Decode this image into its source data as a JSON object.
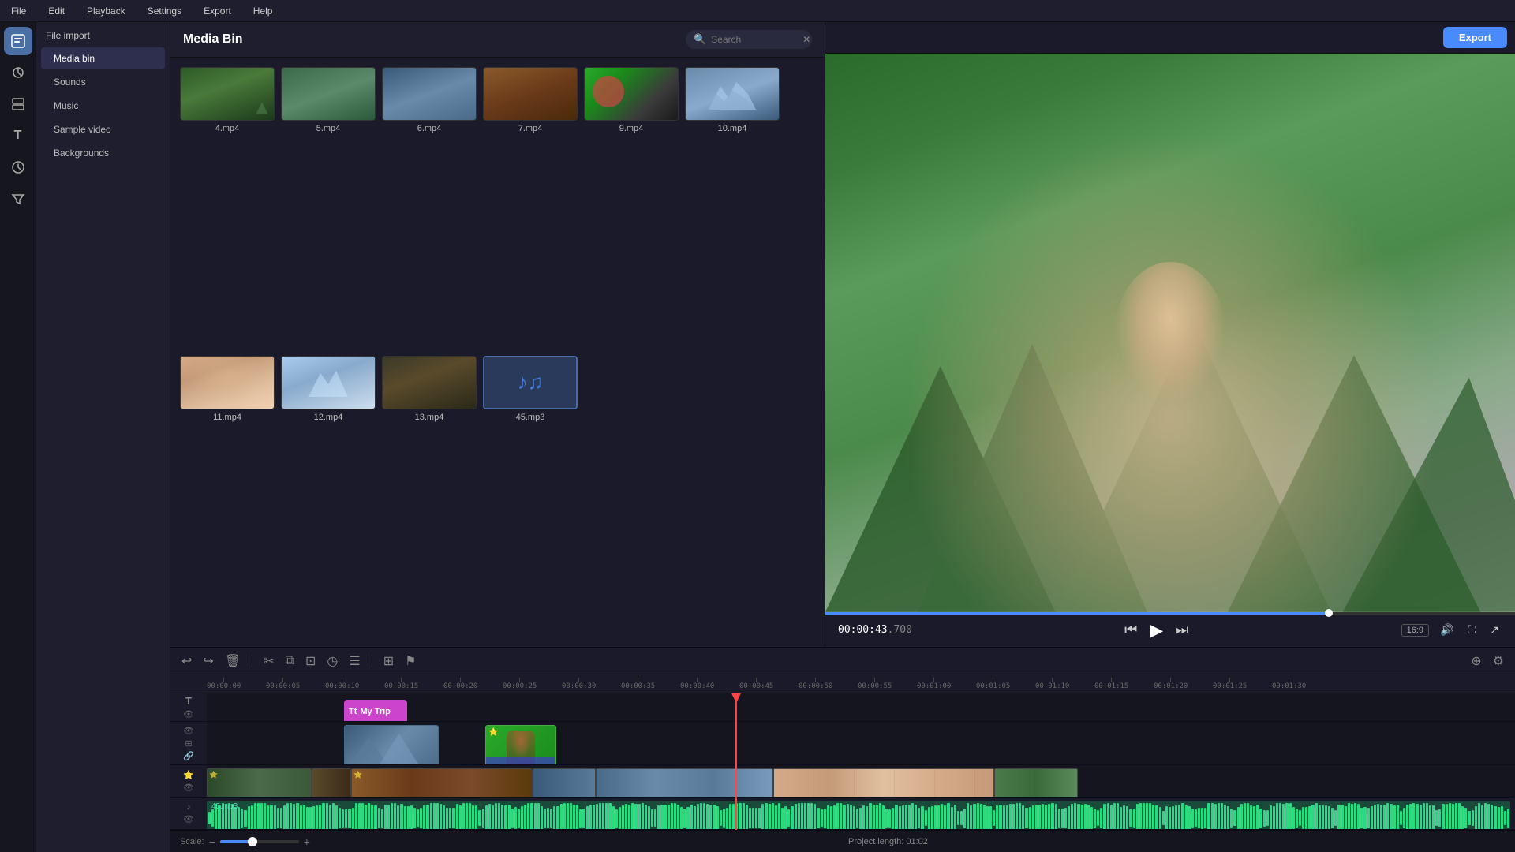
{
  "menu": {
    "items": [
      "File",
      "Edit",
      "Playback",
      "Settings",
      "Export",
      "Help"
    ]
  },
  "sidebar": {
    "icons": [
      {
        "name": "media-icon",
        "symbol": "⬛",
        "active": true
      },
      {
        "name": "effects-icon",
        "symbol": "✦",
        "active": false
      },
      {
        "name": "layers-icon",
        "symbol": "⧉",
        "active": false
      },
      {
        "name": "text-icon",
        "symbol": "T",
        "active": false
      },
      {
        "name": "clock-icon",
        "symbol": "◷",
        "active": false
      },
      {
        "name": "star-icon",
        "symbol": "✱",
        "active": false
      }
    ]
  },
  "file_panel": {
    "header": "File import",
    "items": [
      {
        "label": "Media bin",
        "active": true
      },
      {
        "label": "Sounds",
        "active": false
      },
      {
        "label": "Music",
        "active": false
      },
      {
        "label": "Sample video",
        "active": false
      },
      {
        "label": "Backgrounds",
        "active": false
      }
    ]
  },
  "media_bin": {
    "title": "Media Bin",
    "search_placeholder": "Search",
    "items": [
      {
        "id": "4",
        "label": "4.mp4",
        "type": "video",
        "thumb_class": "thumb-4"
      },
      {
        "id": "5",
        "label": "5.mp4",
        "type": "video",
        "thumb_class": "thumb-5"
      },
      {
        "id": "6",
        "label": "6.mp4",
        "type": "video",
        "thumb_class": "thumb-6"
      },
      {
        "id": "7",
        "label": "7.mp4",
        "type": "video",
        "thumb_class": "thumb-7"
      },
      {
        "id": "9",
        "label": "9.mp4",
        "type": "video",
        "thumb_class": "thumb-9"
      },
      {
        "id": "10",
        "label": "10.mp4",
        "type": "video",
        "thumb_class": "thumb-10"
      },
      {
        "id": "11",
        "label": "11.mp4",
        "type": "video",
        "thumb_class": "thumb-11"
      },
      {
        "id": "12",
        "label": "12.mp4",
        "type": "video",
        "thumb_class": "thumb-12"
      },
      {
        "id": "13",
        "label": "13.mp4",
        "type": "video",
        "thumb_class": "thumb-13"
      },
      {
        "id": "45",
        "label": "45.mp3",
        "type": "audio",
        "thumb_class": "thumb-45"
      }
    ]
  },
  "preview": {
    "time_current": "00:00:43",
    "time_frac": ".700",
    "aspect_ratio": "16:9",
    "export_label": "Export"
  },
  "timeline": {
    "ruler_marks": [
      "00:00:00",
      "00:00:05",
      "00:00:10",
      "00:00:15",
      "00:00:20",
      "00:00:25",
      "00:00:30",
      "00:00:35",
      "00:00:40",
      "00:00:45",
      "00:00:50",
      "00:00:55",
      "00:01:00",
      "00:01:05",
      "00:01:10",
      "00:01:15",
      "00:01:20",
      "00:01:25",
      "00:01:30"
    ],
    "title_clip_label": "My Trip",
    "audio_clip_label": "45.mp3",
    "project_length": "Project length: 01:02"
  },
  "scale": {
    "label": "Scale:",
    "value": 40
  }
}
